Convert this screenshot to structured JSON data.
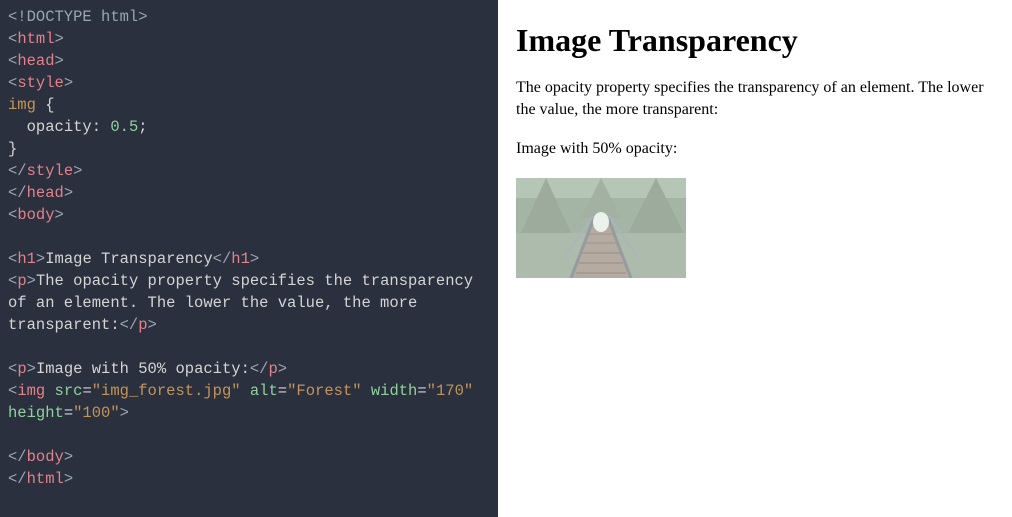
{
  "code": {
    "l1": "<!DOCTYPE html>",
    "l2a": "<",
    "l2b": "html",
    "l2c": ">",
    "l3a": "<",
    "l3b": "head",
    "l3c": ">",
    "l4a": "<",
    "l4b": "style",
    "l4c": ">",
    "l5a": "img",
    "l5b": " {",
    "l6a": "  opacity",
    "l6b": ": ",
    "l6c": "0.5",
    "l6d": ";",
    "l7": "}",
    "l8a": "</",
    "l8b": "style",
    "l8c": ">",
    "l9a": "</",
    "l9b": "head",
    "l9c": ">",
    "l10a": "<",
    "l10b": "body",
    "l10c": ">",
    "l12a": "<",
    "l12b": "h1",
    "l12c": ">",
    "l12d": "Image Transparency",
    "l12e": "</",
    "l12f": "h1",
    "l12g": ">",
    "l13a": "<",
    "l13b": "p",
    "l13c": ">",
    "l13d": "The opacity property specifies the transparency of an element. The lower the value, the more transparent:",
    "l13e": "</",
    "l13f": "p",
    "l13g": ">",
    "l15a": "<",
    "l15b": "p",
    "l15c": ">",
    "l15d": "Image with 50% opacity:",
    "l15e": "</",
    "l15f": "p",
    "l15g": ">",
    "l16a": "<",
    "l16b": "img",
    "l16c": " src",
    "l16d": "=",
    "l16e": "\"img_forest.jpg\"",
    "l16f": " alt",
    "l16g": "=",
    "l16h": "\"Forest\"",
    "l17a": "width",
    "l17b": "=",
    "l17c": "\"170\"",
    "l17d": " height",
    "l17e": "=",
    "l17f": "\"100\"",
    "l17g": ">",
    "l19a": "</",
    "l19b": "body",
    "l19c": ">",
    "l20a": "</",
    "l20b": "html",
    "l20c": ">"
  },
  "preview": {
    "heading": "Image Transparency",
    "para1": "The opacity property specifies the transparency of an element. The lower the value, the more transparent:",
    "para2": "Image with 50% opacity:",
    "img_alt": "Forest",
    "img_width": "170",
    "img_height": "100",
    "opacity": "0.5"
  }
}
